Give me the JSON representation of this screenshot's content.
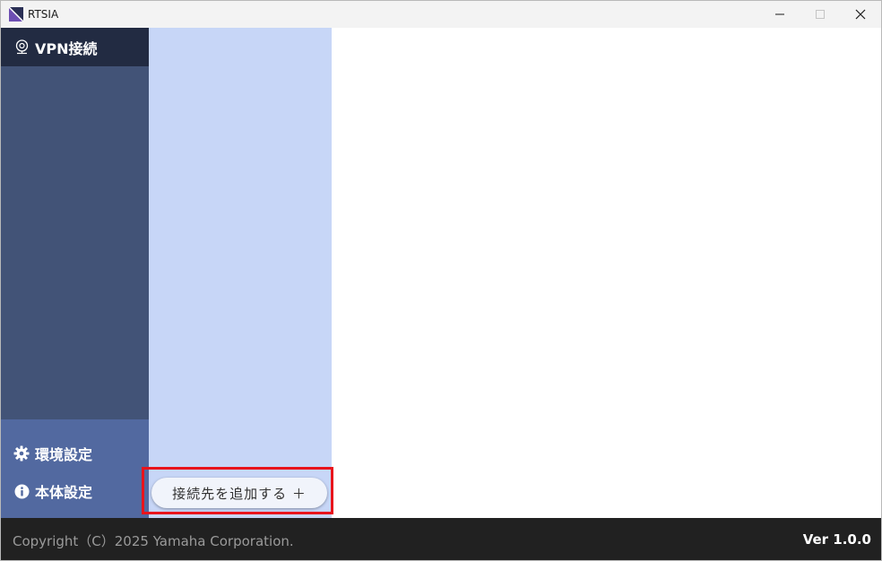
{
  "window": {
    "title": "RTSIA"
  },
  "sidebar": {
    "active_item": {
      "label": "VPN接続",
      "icon": "vpn-icon"
    },
    "bottom_items": [
      {
        "label": "環境設定",
        "icon": "gear-icon"
      },
      {
        "label": "本体設定",
        "icon": "info-icon"
      }
    ]
  },
  "list_panel": {
    "add_button_label": "接続先を追加する ＋"
  },
  "footer": {
    "copyright": "Copyright（C）2025 Yamaha Corporation.",
    "version": "Ver 1.0.0"
  },
  "colors": {
    "sidebar": "#425377",
    "sidebar_active": "#222b42",
    "sidebar_bottom": "#5269a0",
    "list_panel": "#c7d6f7",
    "footer": "#212121",
    "highlight": "#e8141c"
  }
}
